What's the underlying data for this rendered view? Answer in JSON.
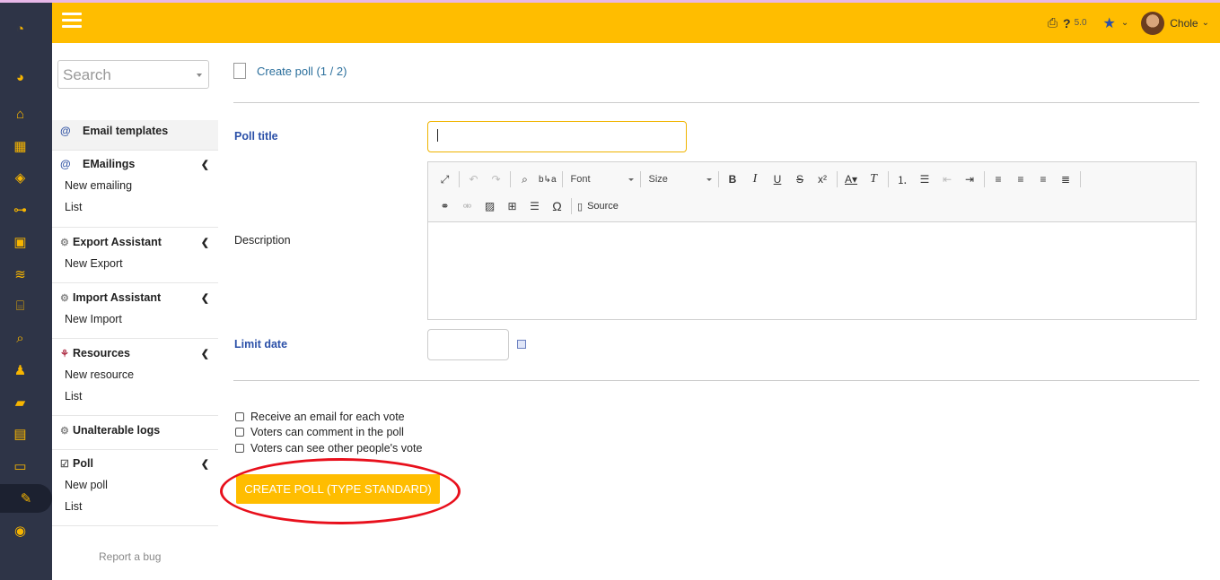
{
  "header": {
    "version": "5.0",
    "user_name": "Chole"
  },
  "sidebar": {
    "search_placeholder": "Search",
    "menus": {
      "email_templates": "Email templates",
      "emailings": {
        "title": "EMailings",
        "links": [
          "New emailing",
          "List"
        ]
      },
      "export": {
        "title": "Export Assistant",
        "links": [
          "New Export"
        ]
      },
      "import": {
        "title": "Import Assistant",
        "links": [
          "New Import"
        ]
      },
      "resources": {
        "title": "Resources",
        "links": [
          "New resource",
          "List"
        ]
      },
      "logs": "Unalterable logs",
      "poll": {
        "title": "Poll",
        "links": [
          "New poll",
          "List"
        ]
      }
    },
    "report_bug": "Report a bug"
  },
  "main": {
    "breadcrumb": "Create poll (1 / 2)",
    "labels": {
      "poll_title": "Poll title",
      "description": "Description",
      "limit_date": "Limit date"
    },
    "editor": {
      "font_label": "Font",
      "size_label": "Size",
      "source_label": "Source"
    },
    "checkboxes": [
      "Receive an email for each vote",
      "Voters can comment in the poll",
      "Voters can see other people's vote"
    ],
    "create_button": "CREATE POLL (TYPE STANDARD)"
  },
  "colors": {
    "header": "#ffbd00",
    "iconbar": "#2e3447",
    "link_blue": "#2b50a8",
    "annotation_red": "#e8101c"
  }
}
